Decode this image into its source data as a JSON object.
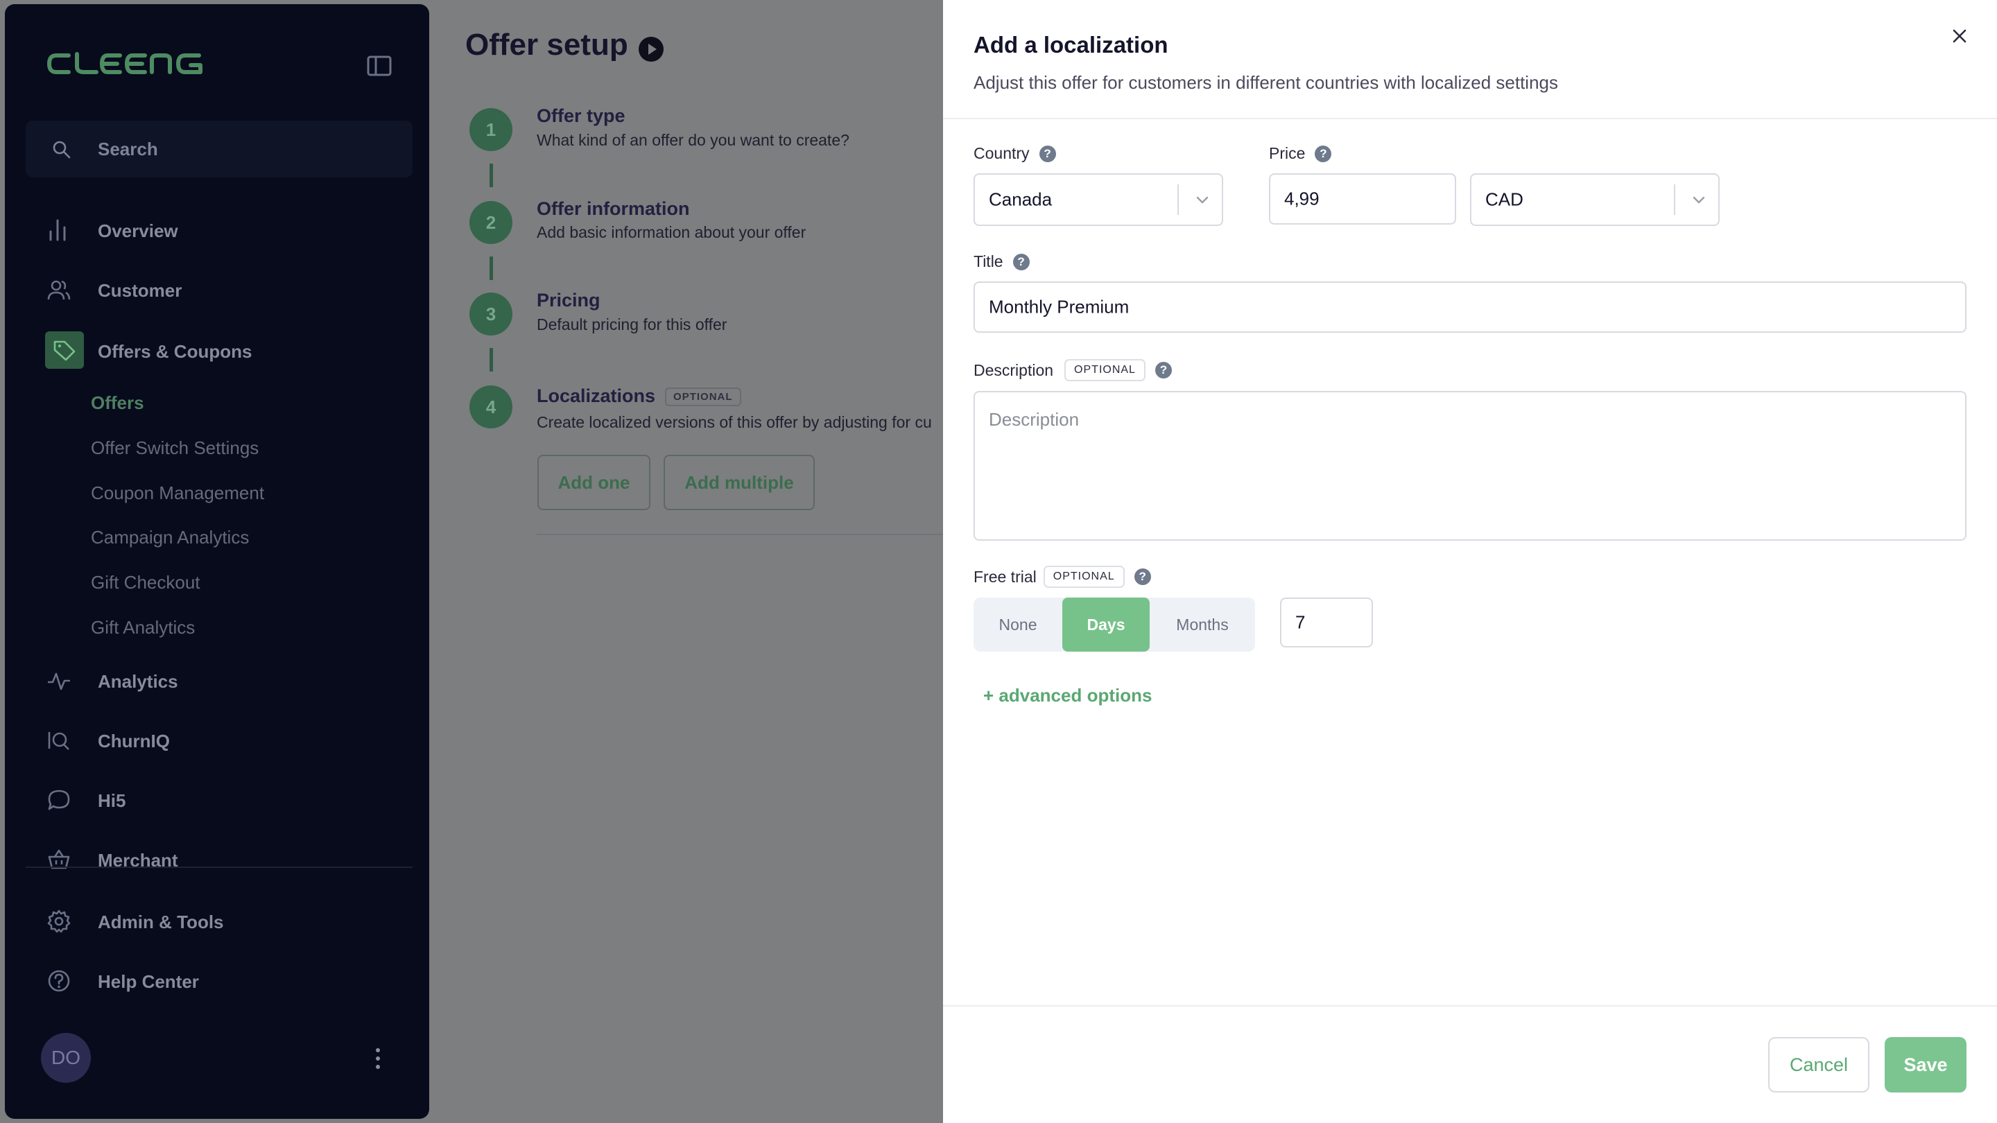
{
  "brand": {
    "logo_text": "CLEENG",
    "accent": "#77c28a"
  },
  "sidebar": {
    "search_label": "Search",
    "nav": [
      {
        "label": "Overview",
        "icon": "bar-chart-icon"
      },
      {
        "label": "Customer",
        "icon": "users-icon"
      },
      {
        "label": "Offers & Coupons",
        "icon": "tag-icon"
      },
      {
        "label": "Analytics",
        "icon": "activity-icon"
      },
      {
        "label": "ChurnIQ",
        "icon": "churniq-icon"
      },
      {
        "label": "Hi5",
        "icon": "chat-bubble-icon"
      },
      {
        "label": "Merchant",
        "icon": "basket-icon"
      },
      {
        "label": "Admin & Tools",
        "icon": "gear-icon"
      },
      {
        "label": "Help Center",
        "icon": "help-circle-icon"
      }
    ],
    "subnav": [
      "Offers",
      "Offer Switch Settings",
      "Coupon Management",
      "Campaign Analytics",
      "Gift Checkout",
      "Gift Analytics"
    ],
    "user_initials": "DO"
  },
  "main": {
    "title": "Offer setup",
    "steps": [
      {
        "num": "1",
        "title": "Offer type",
        "desc": "What kind of an offer do you want to create?"
      },
      {
        "num": "2",
        "title": "Offer information",
        "desc": "Add basic information about your offer"
      },
      {
        "num": "3",
        "title": "Pricing",
        "desc": "Default pricing for this offer"
      },
      {
        "num": "4",
        "title": "Localizations",
        "badge": "OPTIONAL",
        "desc": "Create localized versions of this offer by adjusting for cu"
      }
    ],
    "add_one": "Add one",
    "add_multiple": "Add multiple"
  },
  "panel": {
    "title": "Add a localization",
    "subtitle": "Adjust this offer for customers in different countries with localized settings",
    "country_label": "Country",
    "country_value": "Canada",
    "price_label": "Price",
    "price_value": "4,99",
    "currency_value": "CAD",
    "title_label": "Title",
    "title_value": "Monthly Premium",
    "description_label": "Description",
    "description_badge": "OPTIONAL",
    "description_placeholder": "Description",
    "trial_label": "Free trial",
    "trial_badge": "OPTIONAL",
    "trial_options": [
      "None",
      "Days",
      "Months"
    ],
    "trial_selected": "Days",
    "trial_value": "7",
    "advanced": "+ advanced options",
    "cancel": "Cancel",
    "save": "Save"
  }
}
